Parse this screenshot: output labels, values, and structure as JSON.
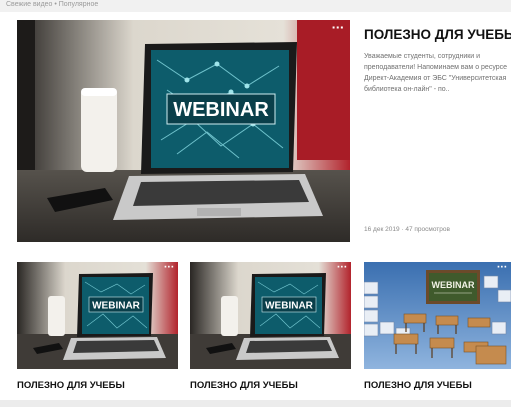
{
  "header_faint_text": "Свежие видео • Популярное",
  "featured": {
    "title": "ПОЛЕЗНО ДЛЯ УЧЕБЫ",
    "description": "Уважаемые студенты, сотрудники и преподаватели! Напоминаем вам о ресурсе Директ-Академия от ЭБС \"Университетская библиотека он-лайн\" - по..",
    "meta": "16 дек 2019 · 47 просмотров",
    "thumb_text": "WEBINAR",
    "menu_glyph": "···"
  },
  "videos": [
    {
      "title": "ПОЛЕЗНО ДЛЯ УЧЕБЫ",
      "thumb_text": "WEBINAR",
      "menu_glyph": "···",
      "thumb_kind": "laptop-webinar"
    },
    {
      "title": "ПОЛЕЗНО ДЛЯ УЧЕБЫ",
      "thumb_text": "WEBINAR",
      "menu_glyph": "···",
      "thumb_kind": "laptop-webinar"
    },
    {
      "title": "ПОЛЕЗНО ДЛЯ УЧЕБЫ",
      "thumb_text": "WEBINAR",
      "menu_glyph": "···",
      "thumb_kind": "classroom-keyboard"
    }
  ],
  "colors": {
    "screen_teal": "#0c5f6e",
    "wall": "#d9d4c8",
    "red_chair": "#b0202a",
    "desk": "#3b3835",
    "chalkboard": "#3f5a2c"
  },
  "icons": {
    "menu": "more-dots-icon"
  }
}
